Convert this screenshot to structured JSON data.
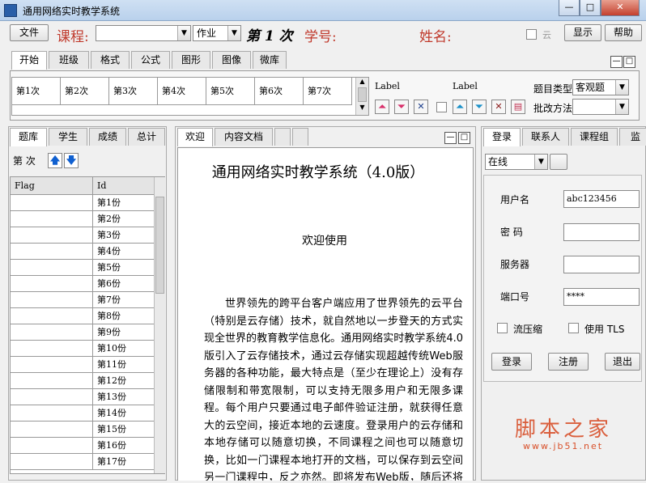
{
  "window": {
    "title": "通用网络实时教学系统",
    "min": "—",
    "max": "□",
    "close": "✕"
  },
  "toolbar": {
    "file": "文件",
    "course_label": "课程:",
    "course_value": "",
    "homework": "作业",
    "session": "第 1 次",
    "student_no_label": "学号:",
    "name_label": "姓名:",
    "cloud": "云",
    "display": "显示",
    "help": "帮助"
  },
  "ribbon": {
    "tabs": [
      "开始",
      "班级",
      "格式",
      "公式",
      "图形",
      "图像",
      "微库"
    ],
    "sessions": [
      "第1次",
      "第2次",
      "第3次",
      "第4次",
      "第5次",
      "第6次",
      "第7次"
    ],
    "label1": "Label",
    "label2": "Label",
    "qtype_label": "题目类型",
    "qtype_value": "客观题",
    "grade_label": "批改方法",
    "grade_value": ""
  },
  "left": {
    "tabs": [
      "题库",
      "学生",
      "成绩",
      "总计"
    ],
    "count_label": "第  次",
    "columns": [
      "Flag",
      "Id"
    ],
    "rows": [
      "第1份",
      "第2份",
      "第3份",
      "第4份",
      "第5份",
      "第6份",
      "第7份",
      "第8份",
      "第9份",
      "第10份",
      "第11份",
      "第12份",
      "第13份",
      "第14份",
      "第15份",
      "第16份",
      "第17份"
    ]
  },
  "center": {
    "tabs": [
      "欢迎",
      "内容文档"
    ],
    "heading": "通用网络实时教学系统（4.0版）",
    "welcome": "欢迎使用",
    "body": "世界领先的跨平台客户端应用了世界领先的云平台（特别是云存储）技术，就自然地以一步登天的方式实现全世界的教育教学信息化。通用网络实时教学系统4.0版引入了云存储技术，通过云存储实现超越传统Web服务器的各种功能，最大特点是（至少在理论上）没有存储限制和带宽限制，可以支持无限多用户和无限多课程。每个用户只要通过电子邮件验证注册，就获得任意大的云空间，接近本地的云速度。登录用户的云存储和本地存储可以随意切换，不同课程之间也可以随意切换，比如一门课程本地打开的文档，可以保存到云空间另一门课程中，反之亦然。即将发布Web版，随后还将发布移动版，不同平台版"
  },
  "right": {
    "tabs": [
      "登录",
      "联系人",
      "课程组",
      "监"
    ],
    "status": "在线",
    "username_label": "用户名",
    "username_value": "abc123456",
    "password_label": "密   码",
    "password_value": "",
    "server_label": "服务器",
    "server_value": "",
    "port_label": "端口号",
    "port_value": "****",
    "compress_label": "流压缩",
    "tls_label": "使用 TLS",
    "login_btn": "登录",
    "register_btn": "注册",
    "exit_btn": "退出"
  },
  "watermark": {
    "text": "脚本之家",
    "url": "www.jb51.net"
  },
  "colors": {
    "accent_red": "#c0392b",
    "titlebar": "#c4d8f0",
    "arrow_blue": "#1060d0",
    "arrow_pink": "#d8306a"
  }
}
